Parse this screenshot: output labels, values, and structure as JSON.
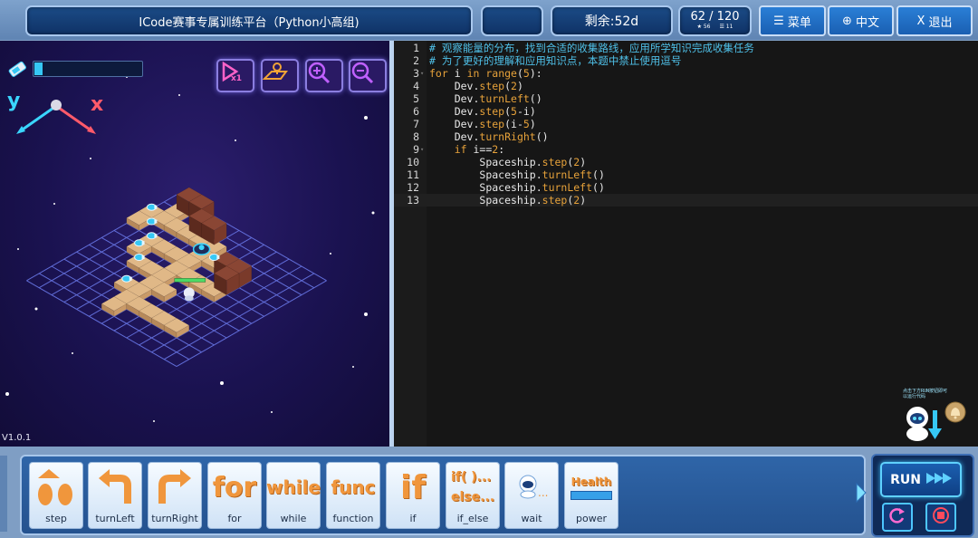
{
  "topbar": {
    "title": "ICode赛事专属训练平台（Python小高组)",
    "remaining": "剩余:52d",
    "score_main": "62 / 120",
    "score_sub_a": "56",
    "score_sub_b": "11",
    "menu_label": "菜单",
    "lang_label": "中文",
    "exit_label": "退出"
  },
  "game": {
    "axis_y": "y",
    "axis_x": "x",
    "version": "V1.0.1",
    "energy_level": 0.08,
    "hint": "点击下方RUN按钮即可以运行代码",
    "colors": {
      "tile": "#e0b887",
      "block": "#7a3a2a",
      "grid": "#6d7df0",
      "energy": "#36c8f5"
    }
  },
  "editor": {
    "lines": [
      {
        "n": "1",
        "fold": false,
        "indent": "",
        "tokens": [
          [
            "c",
            "# 观察能量的分布，找到合适的收集路线，应用所学知识完成收集任务"
          ]
        ]
      },
      {
        "n": "2",
        "fold": false,
        "indent": "",
        "tokens": [
          [
            "c",
            "# 为了更好的理解和应用知识点，本题中禁止使用逗号"
          ]
        ]
      },
      {
        "n": "3",
        "fold": true,
        "indent": "",
        "tokens": [
          [
            "k",
            "for"
          ],
          [
            "t",
            " i "
          ],
          [
            "k",
            "in"
          ],
          [
            "t",
            " "
          ],
          [
            "f",
            "range"
          ],
          [
            "t",
            "("
          ],
          [
            "n",
            "5"
          ],
          [
            "t",
            "):"
          ]
        ]
      },
      {
        "n": "4",
        "fold": false,
        "indent": "    ",
        "tokens": [
          [
            "t",
            "Dev."
          ],
          [
            "f",
            "step"
          ],
          [
            "t",
            "("
          ],
          [
            "n",
            "2"
          ],
          [
            "t",
            ")"
          ]
        ]
      },
      {
        "n": "5",
        "fold": false,
        "indent": "    ",
        "tokens": [
          [
            "t",
            "Dev."
          ],
          [
            "f",
            "turnLeft"
          ],
          [
            "t",
            "()"
          ]
        ]
      },
      {
        "n": "6",
        "fold": false,
        "indent": "    ",
        "tokens": [
          [
            "t",
            "Dev."
          ],
          [
            "f",
            "step"
          ],
          [
            "t",
            "("
          ],
          [
            "n",
            "5"
          ],
          [
            "t",
            "-i)"
          ]
        ]
      },
      {
        "n": "7",
        "fold": false,
        "indent": "    ",
        "tokens": [
          [
            "t",
            "Dev."
          ],
          [
            "f",
            "step"
          ],
          [
            "t",
            "(i-"
          ],
          [
            "n",
            "5"
          ],
          [
            "t",
            ")"
          ]
        ]
      },
      {
        "n": "8",
        "fold": false,
        "indent": "    ",
        "tokens": [
          [
            "t",
            "Dev."
          ],
          [
            "f",
            "turnRight"
          ],
          [
            "t",
            "()"
          ]
        ]
      },
      {
        "n": "9",
        "fold": true,
        "indent": "    ",
        "tokens": [
          [
            "k",
            "if"
          ],
          [
            "t",
            " i=="
          ],
          [
            "n",
            "2"
          ],
          [
            "t",
            ":"
          ]
        ]
      },
      {
        "n": "10",
        "fold": false,
        "indent": "        ",
        "tokens": [
          [
            "t",
            "Spaceship."
          ],
          [
            "f",
            "step"
          ],
          [
            "t",
            "("
          ],
          [
            "n",
            "2"
          ],
          [
            "t",
            ")"
          ]
        ]
      },
      {
        "n": "11",
        "fold": false,
        "indent": "        ",
        "tokens": [
          [
            "t",
            "Spaceship."
          ],
          [
            "f",
            "turnLeft"
          ],
          [
            "t",
            "()"
          ]
        ]
      },
      {
        "n": "12",
        "fold": false,
        "indent": "        ",
        "tokens": [
          [
            "t",
            "Spaceship."
          ],
          [
            "f",
            "turnLeft"
          ],
          [
            "t",
            "()"
          ]
        ]
      },
      {
        "n": "13",
        "fold": false,
        "indent": "        ",
        "tokens": [
          [
            "t",
            "Spaceship."
          ],
          [
            "f",
            "step"
          ],
          [
            "t",
            "("
          ],
          [
            "n",
            "2"
          ],
          [
            "t",
            ")"
          ]
        ]
      }
    ]
  },
  "toolbox": {
    "tools": [
      {
        "id": "step",
        "label": "step",
        "icon": "step-icon"
      },
      {
        "id": "turnLeft",
        "label": "turnLeft",
        "icon": "turn-left-icon"
      },
      {
        "id": "turnRight",
        "label": "turnRight",
        "icon": "turn-right-icon"
      },
      {
        "id": "for",
        "label": "for",
        "icon": "for",
        "word": "for"
      },
      {
        "id": "while",
        "label": "while",
        "icon": "while",
        "word": "while"
      },
      {
        "id": "function",
        "label": "function",
        "icon": "func",
        "word": "func"
      },
      {
        "id": "if",
        "label": "if",
        "icon": "if",
        "word": "if"
      },
      {
        "id": "if_else",
        "label": "if_else",
        "icon": "if-else",
        "word1": "if( )...",
        "word2": "else..."
      },
      {
        "id": "wait",
        "label": "wait",
        "icon": "wait-icon"
      },
      {
        "id": "power",
        "label": "power",
        "icon": "health-icon",
        "word": "Health"
      }
    ]
  },
  "run": {
    "label": "RUN"
  }
}
